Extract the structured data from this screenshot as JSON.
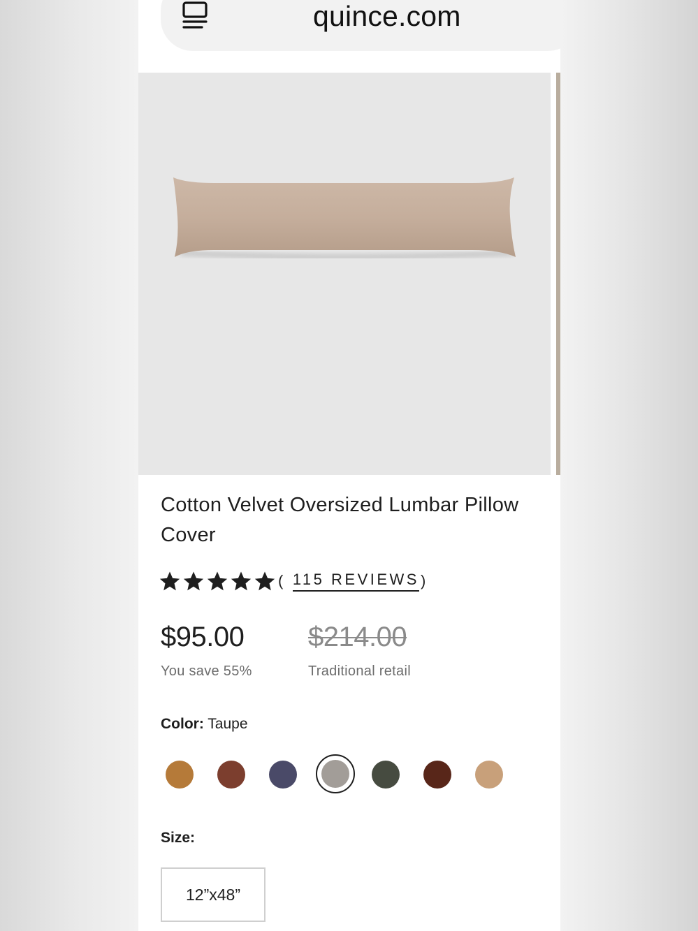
{
  "browser": {
    "url": "quince.com",
    "icon": "tabs-icon"
  },
  "product": {
    "title": "Cotton Velvet Oversized Lumbar Pillow Cover",
    "image_alt_icon": "lumbar-pillow-image",
    "rating": {
      "stars": 5,
      "max": 5,
      "open": "(",
      "reviews_label": "115 REVIEWS",
      "close": ")"
    },
    "price": "$95.00",
    "savings": "You save 55%",
    "retail_price": "$214.00",
    "retail_label": "Traditional retail",
    "color_label": "Color:",
    "color_value": "Taupe",
    "swatches": [
      {
        "name": "ochre",
        "color": "#b57a39",
        "selected": false
      },
      {
        "name": "rust",
        "color": "#7c3e2e",
        "selected": false
      },
      {
        "name": "navy",
        "color": "#4a4a68",
        "selected": false
      },
      {
        "name": "taupe",
        "color": "#a29d98",
        "selected": true
      },
      {
        "name": "olive",
        "color": "#464b40",
        "selected": false
      },
      {
        "name": "chocolate",
        "color": "#582619",
        "selected": false
      },
      {
        "name": "camel",
        "color": "#c8a07a",
        "selected": false
      }
    ],
    "size_label": "Size:",
    "size_option": "12”x48”"
  },
  "colors": {
    "pillow": "#c7b19f",
    "gallery_bg": "#e7e7e7"
  }
}
